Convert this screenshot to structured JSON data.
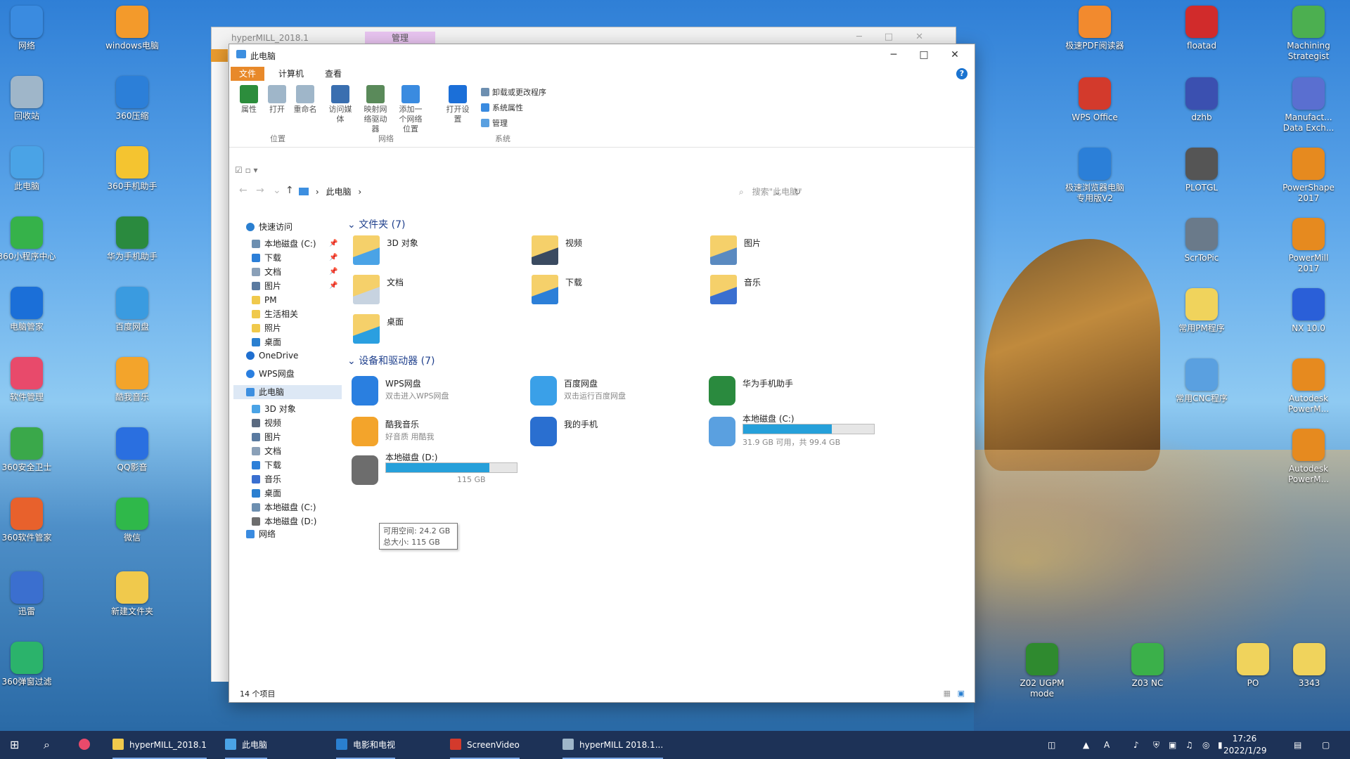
{
  "desktop": {
    "left_icons": [
      {
        "label": "网络",
        "color": "#3a8be0"
      },
      {
        "label": "windows电脑",
        "color": "#f39a2b"
      },
      {
        "label": "回收站",
        "color": "#9fb6c9"
      },
      {
        "label": "360压缩",
        "color": "#2c7fd8"
      },
      {
        "label": "此电脑",
        "color": "#4aa3e6"
      },
      {
        "label": "360手机助手",
        "color": "#f4c430"
      },
      {
        "label": "360小程序中心",
        "color": "#36b24a"
      },
      {
        "label": "华为手机助手",
        "color": "#2a8a3e"
      },
      {
        "label": "电脑管家",
        "color": "#1b6fd8"
      },
      {
        "label": "百度网盘",
        "color": "#3a9be0"
      },
      {
        "label": "软件管理",
        "color": "#e84a6b"
      },
      {
        "label": "酷我音乐",
        "color": "#f3a42b"
      },
      {
        "label": "360安全卫士",
        "color": "#3aa84a"
      },
      {
        "label": "QQ影音",
        "color": "#2a6fe0"
      },
      {
        "label": "360软件管家",
        "color": "#e8612c"
      },
      {
        "label": "微信",
        "color": "#2fb84a"
      },
      {
        "label": "迅雷",
        "color": "#3b6fcf"
      },
      {
        "label": "新建文件夹",
        "color": "#f0c94c"
      },
      {
        "label": "360弹窗过滤",
        "color": "#2bb36b"
      }
    ],
    "right_icons": [
      {
        "label": "极速PDF阅读器",
        "color": "#f28a2e"
      },
      {
        "label": "floatad",
        "color": "#d12b2b"
      },
      {
        "label": "Machining Strategist",
        "color": "#4caf50"
      },
      {
        "label": "WPS Office",
        "color": "#d33a2c"
      },
      {
        "label": "dzhb",
        "color": "#3b50b0"
      },
      {
        "label": "Manufact... Data Exch...",
        "color": "#5a6fd0"
      },
      {
        "label": "极速浏览器电脑专用版V2",
        "color": "#2b7fd8"
      },
      {
        "label": "PLOTGL",
        "color": "#555555"
      },
      {
        "label": "PowerShape 2017",
        "color": "#e68a1f"
      },
      {
        "label": "ScrToPic",
        "color": "#6a7a8a"
      },
      {
        "label": "PowerMill 2017",
        "color": "#e68a1f"
      },
      {
        "label": "常用PM程序",
        "color": "#f0d35c"
      },
      {
        "label": "NX 10.0",
        "color": "#2a5fd8"
      },
      {
        "label": "常用CNC程序",
        "color": "#5aa0e0"
      },
      {
        "label": "Autodesk PowerM...",
        "color": "#e68a1f"
      },
      {
        "label": "Autodesk PowerM...",
        "color": "#e68a1f"
      },
      {
        "label": "Z02 UGPM mode",
        "color": "#2f8a2f"
      },
      {
        "label": "Z03 NC",
        "color": "#3bb04a"
      },
      {
        "label": "PO",
        "color": "#f0d35c"
      },
      {
        "label": "3343",
        "color": "#f0d35c"
      }
    ]
  },
  "back_window": {
    "title": "hyperMILL_2018.1",
    "context_tab": "管理"
  },
  "explorer": {
    "title": "此电脑",
    "ribbon_tabs": [
      "文件",
      "计算机",
      "查看"
    ],
    "help": "?",
    "ribbon_buttons": [
      {
        "label": "属性",
        "color": "#2c8d3c"
      },
      {
        "label": "打开",
        "color": "#9fb6c9"
      },
      {
        "label": "重命名",
        "color": "#9fb6c9"
      },
      {
        "label": "访问媒体",
        "color": "#3a6fb0"
      },
      {
        "label": "映射网络驱动器",
        "color": "#5a8a5a"
      },
      {
        "label": "添加一个网络位置",
        "color": "#3a8be0"
      },
      {
        "label": "打开设置",
        "color": "#1b6fd8"
      }
    ],
    "ribbon_small": [
      "卸载或更改程序",
      "系统属性",
      "管理"
    ],
    "ribbon_groups": [
      "位置",
      "网络",
      "系统"
    ],
    "address": {
      "path_root": "此电脑",
      "separator": "›"
    },
    "search_placeholder": "搜索\"此电脑\"",
    "nav": {
      "quick_access": "快速访问",
      "quick_items": [
        {
          "label": "本地磁盘 (C:)",
          "color": "#6d8fb0"
        },
        {
          "label": "下载",
          "color": "#2c7fd8"
        },
        {
          "label": "文档",
          "color": "#8aa0b8"
        },
        {
          "label": "图片",
          "color": "#5a7aa0"
        },
        {
          "label": "PM",
          "color": "#f0c94c"
        },
        {
          "label": "生活相关",
          "color": "#f0c94c"
        },
        {
          "label": "照片",
          "color": "#f0c94c"
        },
        {
          "label": "桌面",
          "color": "#2a7fd0"
        }
      ],
      "onedrive": "OneDrive",
      "wps": "WPS网盘",
      "this_pc": "此电脑",
      "pc_items": [
        {
          "label": "3D 对象",
          "color": "#4aa3e6"
        },
        {
          "label": "视频",
          "color": "#5a6a80"
        },
        {
          "label": "图片",
          "color": "#5a7aa0"
        },
        {
          "label": "文档",
          "color": "#8aa0b8"
        },
        {
          "label": "下载",
          "color": "#2c7fd8"
        },
        {
          "label": "音乐",
          "color": "#3a6fd0"
        },
        {
          "label": "桌面",
          "color": "#2a7fd0"
        },
        {
          "label": "本地磁盘 (C:)",
          "color": "#6d8fb0"
        },
        {
          "label": "本地磁盘 (D:)",
          "color": "#6d6d6d"
        }
      ],
      "network": "网络"
    },
    "folders_header": "文件夹 (7)",
    "folders": [
      {
        "label": "3D 对象",
        "color": "#4aa3e6"
      },
      {
        "label": "视频",
        "color": "#3a4a60"
      },
      {
        "label": "图片",
        "color": "#5a8ac0"
      },
      {
        "label": "文档",
        "color": "#c7d3e0"
      },
      {
        "label": "下载",
        "color": "#2c7fd8"
      },
      {
        "label": "音乐",
        "color": "#3a6fd0"
      },
      {
        "label": "桌面",
        "color": "#2a9fe0"
      }
    ],
    "devices_header": "设备和驱动器 (7)",
    "devices": [
      {
        "label": "WPS网盘",
        "sub": "双击进入WPS网盘",
        "color": "#2a7fe0"
      },
      {
        "label": "百度网盘",
        "sub": "双击运行百度网盘",
        "color": "#3aa0e8"
      },
      {
        "label": "华为手机助手",
        "sub": "",
        "color": "#2a8a3e"
      },
      {
        "label": "酷我音乐",
        "sub": "好音质 用酷我",
        "color": "#f3a42b"
      },
      {
        "label": "我的手机",
        "sub": "",
        "color": "#2a6fd0"
      },
      {
        "label": "本地磁盘 (C:)",
        "sub": "31.9 GB 可用，共 99.4 GB",
        "color": "#5aa0e0",
        "used_fraction": 0.68
      },
      {
        "label": "本地磁盘 (D:)",
        "sub": "115 GB",
        "color": "#6d6d6d",
        "used_fraction": 0.79
      }
    ],
    "tooltip": {
      "line1": "可用空间: 24.2 GB",
      "line2": "总大小: 115 GB"
    },
    "status": "14 个项目"
  },
  "taskbar": {
    "items": [
      {
        "label": "hyperMILL_2018.1",
        "color": "#f0c94c"
      },
      {
        "label": "此电脑",
        "color": "#4aa3e6"
      },
      {
        "label": "电影和电视",
        "color": "#2a7fd0"
      },
      {
        "label": "ScreenVideo",
        "color": "#d33a2c"
      },
      {
        "label": "hyperMILL 2018.1...",
        "color": "#9fb6c9"
      }
    ],
    "time": "17:26",
    "date": "2022/1/29"
  }
}
